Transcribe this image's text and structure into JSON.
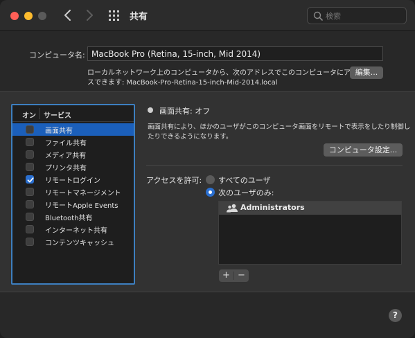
{
  "titlebar": {
    "title": "共有",
    "search_placeholder": "検索"
  },
  "computer_name": {
    "label": "コンピュータ名:",
    "value": "MacBook Pro (Retina, 15-inch, Mid 2014)",
    "desc_line1": "ローカルネットワーク上のコンピュータから、次のアドレスでこのコンピュータにアクセ",
    "desc_line2": "スできます: MacBook-Pro-Retina-15-inch-Mid-2014.local",
    "edit_label": "編集..."
  },
  "services": {
    "header_on": "オン",
    "header_service": "サービス",
    "items": [
      {
        "label": "画面共有",
        "checked": false,
        "selected": true
      },
      {
        "label": "ファイル共有",
        "checked": false,
        "selected": false
      },
      {
        "label": "メディア共有",
        "checked": false,
        "selected": false
      },
      {
        "label": "プリンタ共有",
        "checked": false,
        "selected": false
      },
      {
        "label": "リモートログイン",
        "checked": true,
        "selected": false
      },
      {
        "label": "リモートマネージメント",
        "checked": false,
        "selected": false
      },
      {
        "label": "リモートApple Events",
        "checked": false,
        "selected": false
      },
      {
        "label": "Bluetooth共有",
        "checked": false,
        "selected": false
      },
      {
        "label": "インターネット共有",
        "checked": false,
        "selected": false
      },
      {
        "label": "コンテンツキャッシュ",
        "checked": false,
        "selected": false
      }
    ]
  },
  "detail": {
    "status": "画面共有: オフ",
    "desc_line1": "画面共有により、ほかのユーザがこのコンピュータ画面をリモートで表示をしたり制御し",
    "desc_line2": "たりできるようになります。",
    "computer_settings_label": "コンピュータ設定...",
    "access_label": "アクセスを許可:",
    "radio_all": "すべてのユーザ",
    "radio_only": "次のユーザのみ:",
    "users": [
      "Administrators"
    ],
    "add_label": "+",
    "remove_label": "−"
  },
  "help_label": "?"
}
